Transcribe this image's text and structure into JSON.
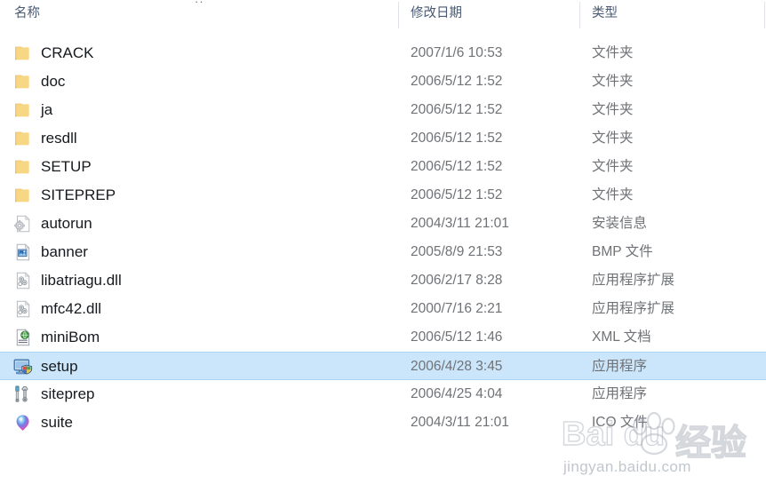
{
  "window": {
    "top_fragment": "··"
  },
  "columns": {
    "name": "名称",
    "date_modified": "修改日期",
    "type": "类型"
  },
  "colors": {
    "selection_fill": "#cbe6fb",
    "selection_border": "#a9d4f5",
    "header_text": "#4a5a72",
    "primary_text": "#16191d",
    "secondary_text": "#6f7276",
    "folder_yellow": "#f5d27a",
    "separator": "#dfe3e8"
  },
  "files": [
    {
      "name": "CRACK",
      "date": "2007/1/6 10:53",
      "type": "文件夹",
      "icon": "folder-icon",
      "selected": false
    },
    {
      "name": "doc",
      "date": "2006/5/12 1:52",
      "type": "文件夹",
      "icon": "folder-icon",
      "selected": false
    },
    {
      "name": "ja",
      "date": "2006/5/12 1:52",
      "type": "文件夹",
      "icon": "folder-icon",
      "selected": false
    },
    {
      "name": "resdll",
      "date": "2006/5/12 1:52",
      "type": "文件夹",
      "icon": "folder-icon",
      "selected": false
    },
    {
      "name": "SETUP",
      "date": "2006/5/12 1:52",
      "type": "文件夹",
      "icon": "folder-icon",
      "selected": false
    },
    {
      "name": "SITEPREP",
      "date": "2006/5/12 1:52",
      "type": "文件夹",
      "icon": "folder-icon",
      "selected": false
    },
    {
      "name": "autorun",
      "date": "2004/3/11 21:01",
      "type": "安装信息",
      "icon": "setup-information-icon",
      "selected": false
    },
    {
      "name": "banner",
      "date": "2005/8/9 21:53",
      "type": "BMP 文件",
      "icon": "bitmap-image-icon",
      "selected": false
    },
    {
      "name": "libatriagu.dll",
      "date": "2006/2/17 8:28",
      "type": "应用程序扩展",
      "icon": "dll-icon",
      "selected": false
    },
    {
      "name": "mfc42.dll",
      "date": "2000/7/16 2:21",
      "type": "应用程序扩展",
      "icon": "dll-icon",
      "selected": false
    },
    {
      "name": "miniBom",
      "date": "2006/5/12 1:46",
      "type": "XML 文档",
      "icon": "xml-document-icon",
      "selected": false
    },
    {
      "name": "setup",
      "date": "2006/4/28 3:45",
      "type": "应用程序",
      "icon": "application-shield-icon",
      "selected": true
    },
    {
      "name": "siteprep",
      "date": "2006/4/25 4:04",
      "type": "应用程序",
      "icon": "tools-icon",
      "selected": false
    },
    {
      "name": "suite",
      "date": "2004/3/11 21:01",
      "type": "ICO 文件",
      "icon": "ico-balloon-icon",
      "selected": false
    }
  ],
  "watermark": {
    "brand": "Bai   du",
    "brand_cn": "经验",
    "url": "jingyan.baidu.com",
    "paw": "paw-print-icon"
  }
}
